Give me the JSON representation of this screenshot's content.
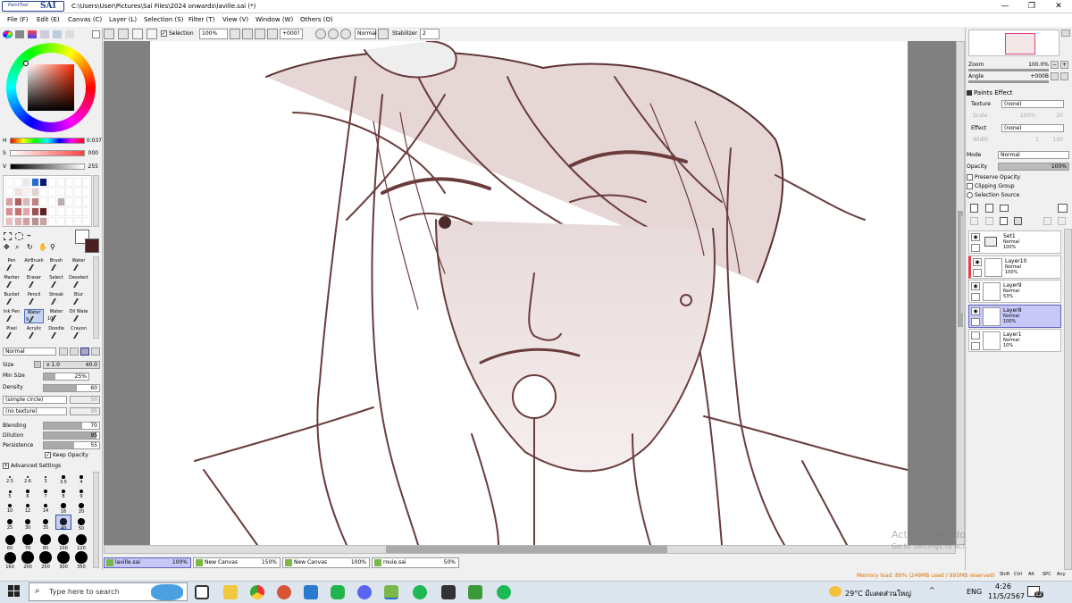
{
  "app": {
    "logo_top": "PaintTool",
    "logo_main": "SAI",
    "title": "C:\\Users\\User\\Pictures\\Sai Files\\2024 onwards\\laville.sai (*)"
  },
  "window_controls": {
    "minimize": "—",
    "restore": "❐",
    "close": "✕"
  },
  "menu": [
    "File (F)",
    "Edit (E)",
    "Canvas (C)",
    "Layer (L)",
    "Selection (S)",
    "Filter (T)",
    "View (V)",
    "Window (W)",
    "Others (O)"
  ],
  "toolbar": {
    "selection_label": "Selection",
    "zoom": "100%",
    "angle": "+000?",
    "blend_mode": "Normal",
    "stabilizer_label": "Stabilizer",
    "stabilizer_value": "2"
  },
  "color": {
    "h_label": "H",
    "h_value": "0:037",
    "s_label": "S",
    "s_value": "000",
    "v_label": "V",
    "v_value": "255",
    "primary": "#4a1f1f",
    "secondary": "#ffffff"
  },
  "swatches": [
    "#ffffff",
    "#ffffff",
    "#e8e8f0",
    "#2a6ad0",
    "#0a1a70",
    "#ffffff",
    "#ffffff",
    "#ffffff",
    "#ffffff",
    "#ffffff",
    "#ffffff",
    "#f0e0e0",
    "#f8f0f0",
    "#e0d0d0",
    "#ffffff",
    "#ffffff",
    "#ffffff",
    "#ffffff",
    "#ffffff",
    "#ffffff",
    "#d8a0a0",
    "#b06060",
    "#d8b8b8",
    "#c08080",
    "#ffffff",
    "#ffffff",
    "#b8b0b0",
    "#ffffff",
    "#ffffff",
    "#ffffff",
    "#d89090",
    "#c87070",
    "#e0a8a8",
    "#a05050",
    "#602020",
    "#ffffff",
    "#ffffff",
    "#ffffff",
    "#ffffff",
    "#ffffff",
    "#e8c0c0",
    "#e0b0b0",
    "#d0a0a0",
    "#b89090",
    "#c8a0a0",
    "#ffffff",
    "#ffffff",
    "#ffffff",
    "#ffffff",
    "#ffffff"
  ],
  "tools": [
    {
      "name": "Pen"
    },
    {
      "name": "AirBrush"
    },
    {
      "name": "Brush"
    },
    {
      "name": "Water"
    },
    {
      "name": "Marker"
    },
    {
      "name": "Eraser"
    },
    {
      "name": "Select"
    },
    {
      "name": "Deselect"
    },
    {
      "name": "Bucket"
    },
    {
      "name": "Pencil"
    },
    {
      "name": "Streak"
    },
    {
      "name": "Blur"
    },
    {
      "name": "Ink Pen"
    },
    {
      "name": "Water",
      "sub": "9"
    },
    {
      "name": "Water",
      "sub": "10"
    },
    {
      "name": "Oil Wate"
    },
    {
      "name": "Pixel"
    },
    {
      "name": "Acrylic"
    },
    {
      "name": "Doodle"
    },
    {
      "name": "Crayon"
    }
  ],
  "brush": {
    "blend": "Normal",
    "size_label": "Size",
    "size_mult": "x 1.0",
    "size_value": "40.0",
    "minsize_label": "Min Size",
    "minsize_value": "25%",
    "density_label": "Density",
    "density_value": "60",
    "shape": "(simple circle)",
    "shape_value": "50",
    "texture": "(no texture)",
    "texture_value": "95",
    "blending_label": "Blending",
    "blending_value": "70",
    "dilution_label": "Dilution",
    "dilution_value": "95",
    "persistence_label": "Persistence",
    "persistence_value": "55",
    "keep_opacity": "Keep Opacity",
    "advanced": "Advanced Settings"
  },
  "brush_sizes": {
    "row0": [
      "2.5",
      "2.6",
      "3",
      "3.5",
      "4"
    ],
    "row1": [
      "5",
      "6",
      "7",
      "8",
      "9"
    ],
    "row2": [
      "10",
      "12",
      "14",
      "16",
      "20"
    ],
    "row3": [
      "25",
      "30",
      "35",
      "40",
      "50"
    ],
    "row4": [
      "60",
      "70",
      "80",
      "100",
      "120"
    ],
    "row5": [
      "160",
      "200",
      "250",
      "300",
      "350"
    ]
  },
  "navigator": {
    "zoom_label": "Zoom",
    "zoom_value": "100.0%",
    "angle_label": "Angle",
    "angle_value": "+000B"
  },
  "paints_effect": {
    "title": "Paints Effect",
    "texture_label": "Texture",
    "texture_value": "(none)",
    "scale_label": "Scale",
    "scale_value": "100%",
    "scale_num": "20",
    "effect_label": "Effect",
    "effect_value": "(none)",
    "width_label": "Width",
    "width_value": "1",
    "width_num": "100"
  },
  "layer_props": {
    "mode_label": "Mode",
    "mode_value": "Normal",
    "opacity_label": "Opacity",
    "opacity_value": "100%",
    "preserve": "Preserve Opacity",
    "clipping": "Clipping Group",
    "selsource": "Selection Source"
  },
  "layers": [
    {
      "name": "Set1",
      "mode": "Normal",
      "opacity": "100%",
      "visible": true,
      "folder": true
    },
    {
      "name": "Layer10",
      "mode": "Normal",
      "opacity": "100%",
      "visible": true
    },
    {
      "name": "Layer9",
      "mode": "Normal",
      "opacity": "53%",
      "visible": true
    },
    {
      "name": "Layer8",
      "mode": "Normal",
      "opacity": "100%",
      "visible": true,
      "selected": true
    },
    {
      "name": "Layer1",
      "mode": "Normal",
      "opacity": "10%",
      "visible": false
    }
  ],
  "doc_tabs": [
    {
      "name": "laville.sai",
      "zoom": "100%"
    },
    {
      "name": "New Canvas",
      "zoom": "150%"
    },
    {
      "name": "New Canvas",
      "zoom": "100%"
    },
    {
      "name": "rouie.sai",
      "zoom": "50%"
    }
  ],
  "status": {
    "memory": "Memory load: 89% (249MB used / 995MB reserved)",
    "keys": [
      "Shift",
      "Ctrl",
      "Alt",
      "SPC",
      "Any"
    ]
  },
  "watermark": {
    "line1": "Activate Windows",
    "line2": "Go to Settings to activate Windows."
  },
  "taskbar": {
    "search_placeholder": "Type here to search",
    "weather": "29°C มีแดดส่วนใหญ่",
    "lang": "ENG",
    "time": "4:26",
    "date": "11/5/2567",
    "notif": "12"
  }
}
